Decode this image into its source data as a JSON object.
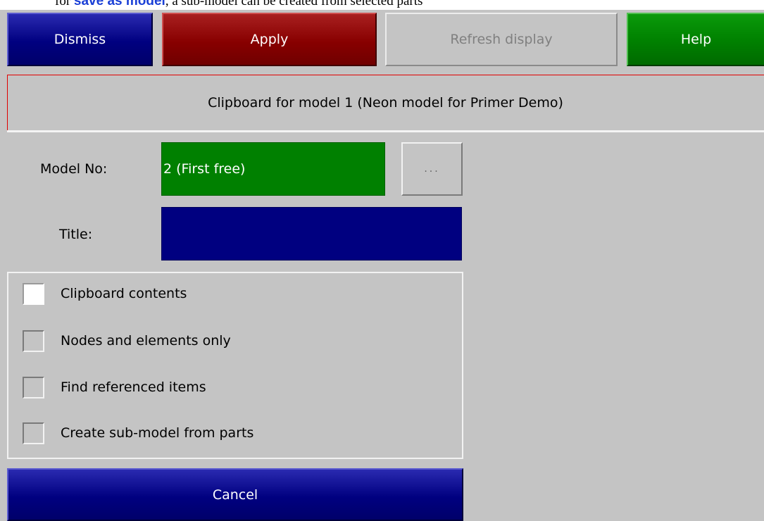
{
  "doc_text": {
    "prefix": "for ",
    "link": "save as model",
    "suffix": ", a sub-model can be created from selected parts"
  },
  "toolbar": {
    "dismiss": "Dismiss",
    "apply": "Apply",
    "refresh": "Refresh display",
    "help": "Help"
  },
  "header": {
    "title": "Clipboard for model 1 (Neon model for Primer Demo)"
  },
  "form": {
    "model_no_label": "Model No:",
    "model_no_value": "2 (First free)",
    "ellipsis": "...",
    "title_label": "Title:",
    "title_value": ""
  },
  "options": [
    {
      "label": "Clipboard contents",
      "checked": true
    },
    {
      "label": "Nodes and elements only",
      "checked": false
    },
    {
      "label": "Find referenced items",
      "checked": false
    },
    {
      "label": "Create sub-model from parts",
      "checked": false
    }
  ],
  "cancel": "Cancel",
  "colors": {
    "background": "#c4c4c4",
    "dismiss": "#000080",
    "apply": "#880000",
    "help": "#008000",
    "model_field": "#008000",
    "title_field": "#000080",
    "header_border": "#e00000"
  }
}
